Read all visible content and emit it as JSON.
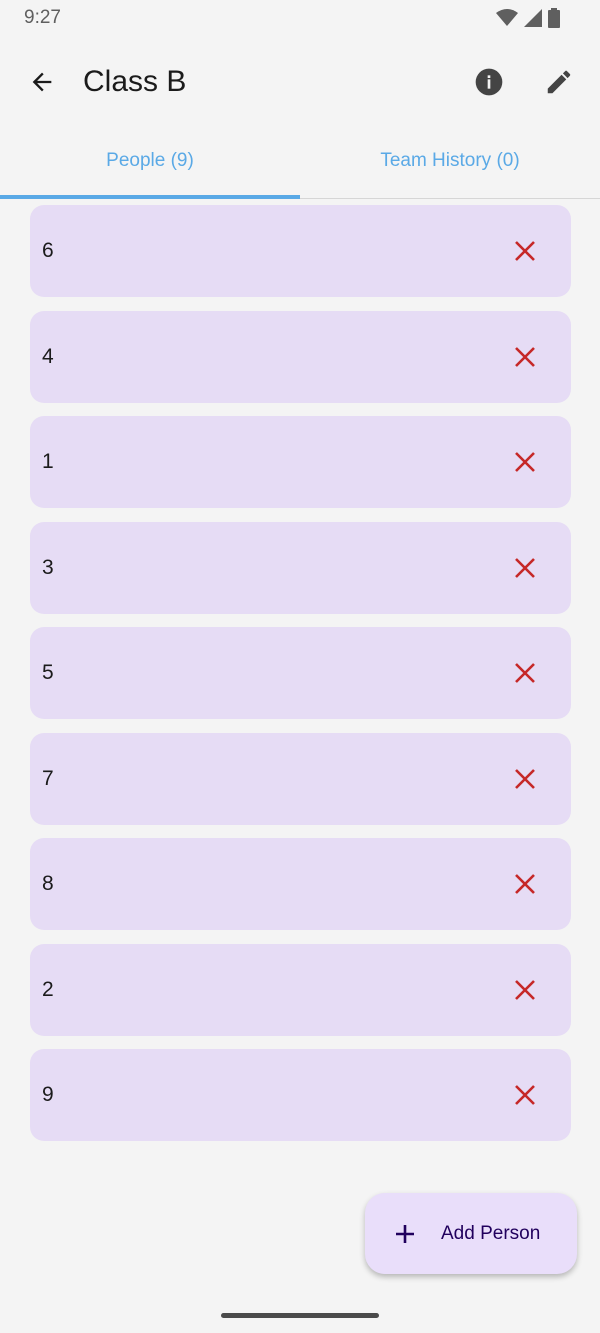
{
  "status_bar": {
    "time": "9:27"
  },
  "app_bar": {
    "title": "Class B"
  },
  "tabs": [
    {
      "label": "People (9)",
      "selected": true
    },
    {
      "label": "Team History (0)",
      "selected": false
    }
  ],
  "people": [
    {
      "name": "6"
    },
    {
      "name": "4"
    },
    {
      "name": "1"
    },
    {
      "name": "3"
    },
    {
      "name": "5"
    },
    {
      "name": "7"
    },
    {
      "name": "8"
    },
    {
      "name": "2"
    },
    {
      "name": "9"
    }
  ],
  "fab": {
    "label": "Add Person"
  },
  "colors": {
    "accent": "#5aa9e6",
    "row_background": "#e6dcf5",
    "remove_icon": "#c62828",
    "fab_background": "#e9defa"
  },
  "icons": {
    "back": "arrow-left-icon",
    "info": "info-icon",
    "edit": "pencil-icon",
    "remove": "close-icon",
    "add": "plus-icon"
  }
}
